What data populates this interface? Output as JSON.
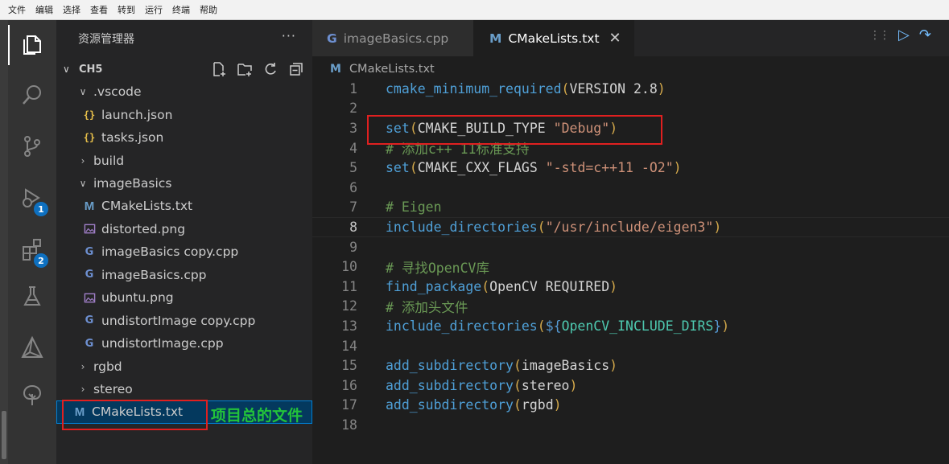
{
  "menu": [
    "文件",
    "编辑",
    "选择",
    "查看",
    "转到",
    "运行",
    "终端",
    "帮助"
  ],
  "activity": {
    "run_badge": "1",
    "scm_badge": "2"
  },
  "sidebar": {
    "title": "资源管理器",
    "more": "···",
    "folder": "CH5",
    "items": [
      {
        "label": ".vscode",
        "kind": "folder-open"
      },
      {
        "label": "launch.json",
        "kind": "json",
        "icon": "{}"
      },
      {
        "label": "tasks.json",
        "kind": "json",
        "icon": "{}"
      },
      {
        "label": "build",
        "kind": "folder-closed"
      },
      {
        "label": "imageBasics",
        "kind": "folder-open"
      },
      {
        "label": "CMakeLists.txt",
        "kind": "cmake",
        "icon": "M"
      },
      {
        "label": "distorted.png",
        "kind": "image"
      },
      {
        "label": "imageBasics copy.cpp",
        "kind": "cpp",
        "icon": "G"
      },
      {
        "label": "imageBasics.cpp",
        "kind": "cpp",
        "icon": "G"
      },
      {
        "label": "ubuntu.png",
        "kind": "image"
      },
      {
        "label": "undistortImage copy.cpp",
        "kind": "cpp",
        "icon": "G"
      },
      {
        "label": "undistortImage.cpp",
        "kind": "cpp",
        "icon": "G"
      },
      {
        "label": "rgbd",
        "kind": "folder-closed"
      },
      {
        "label": "stereo",
        "kind": "folder-closed"
      },
      {
        "label": "CMakeLists.txt",
        "kind": "cmake",
        "icon": "M"
      }
    ],
    "chevron_open": "∨",
    "chevron_closed": "›"
  },
  "annotation": "项目总的文件",
  "editor": {
    "tabs": [
      {
        "label": "imageBasics.cpp",
        "icon": "G"
      },
      {
        "label": "CMakeLists.txt",
        "icon": "M",
        "close": "✕"
      }
    ],
    "breadcrumb": {
      "icon": "M",
      "label": "CMakeLists.txt"
    },
    "current_line": "8",
    "lines": [
      {
        "n": "1",
        "tokens": [
          [
            "fn",
            "cmake_minimum_required"
          ],
          [
            "pn",
            "("
          ],
          [
            "tx",
            "VERSION 2.8"
          ],
          [
            "pn",
            ")"
          ]
        ]
      },
      {
        "n": "2",
        "tokens": []
      },
      {
        "n": "3",
        "tokens": [
          [
            "fn",
            "set"
          ],
          [
            "pn",
            "("
          ],
          [
            "tx",
            "CMAKE_BUILD_TYPE "
          ],
          [
            "st",
            "\"Debug\""
          ],
          [
            "pn",
            ")"
          ]
        ]
      },
      {
        "n": "4",
        "tokens": [
          [
            "cm",
            "# 添加c++ 11标准支持"
          ]
        ]
      },
      {
        "n": "5",
        "tokens": [
          [
            "fn",
            "set"
          ],
          [
            "pn",
            "("
          ],
          [
            "tx",
            "CMAKE_CXX_FLAGS "
          ],
          [
            "st",
            "\"-std=c++11 -O2\""
          ],
          [
            "pn",
            ")"
          ]
        ]
      },
      {
        "n": "6",
        "tokens": []
      },
      {
        "n": "7",
        "tokens": [
          [
            "cm",
            "# Eigen"
          ]
        ]
      },
      {
        "n": "8",
        "tokens": [
          [
            "fn",
            "include_directories"
          ],
          [
            "pn",
            "("
          ],
          [
            "st",
            "\"/usr/include/eigen3\""
          ],
          [
            "pn",
            ")"
          ]
        ]
      },
      {
        "n": "9",
        "tokens": []
      },
      {
        "n": "10",
        "tokens": [
          [
            "cm",
            "# 寻找OpenCV库"
          ]
        ]
      },
      {
        "n": "11",
        "tokens": [
          [
            "fn",
            "find_package"
          ],
          [
            "pn",
            "("
          ],
          [
            "tx",
            "OpenCV REQUIRED"
          ],
          [
            "pn",
            ")"
          ]
        ]
      },
      {
        "n": "12",
        "tokens": [
          [
            "cm",
            "# 添加头文件"
          ]
        ]
      },
      {
        "n": "13",
        "tokens": [
          [
            "fn",
            "include_directories"
          ],
          [
            "pn",
            "("
          ],
          [
            "dl",
            "${"
          ],
          [
            "vr",
            "OpenCV_INCLUDE_DIRS"
          ],
          [
            "dl",
            "}"
          ],
          [
            "pn",
            ")"
          ]
        ]
      },
      {
        "n": "14",
        "tokens": []
      },
      {
        "n": "15",
        "tokens": [
          [
            "fn",
            "add_subdirectory"
          ],
          [
            "pn",
            "("
          ],
          [
            "tx",
            "imageBasics"
          ],
          [
            "pn",
            ")"
          ]
        ]
      },
      {
        "n": "16",
        "tokens": [
          [
            "fn",
            "add_subdirectory"
          ],
          [
            "pn",
            "("
          ],
          [
            "tx",
            "stereo"
          ],
          [
            "pn",
            ")"
          ]
        ]
      },
      {
        "n": "17",
        "tokens": [
          [
            "fn",
            "add_subdirectory"
          ],
          [
            "pn",
            "("
          ],
          [
            "tx",
            "rgbd"
          ],
          [
            "pn",
            ")"
          ]
        ]
      },
      {
        "n": "18",
        "tokens": []
      }
    ]
  },
  "colors": {
    "highlight_box": "#e02020",
    "annotation_text": "#23c33a",
    "accent_badge": "#0e70c0"
  }
}
